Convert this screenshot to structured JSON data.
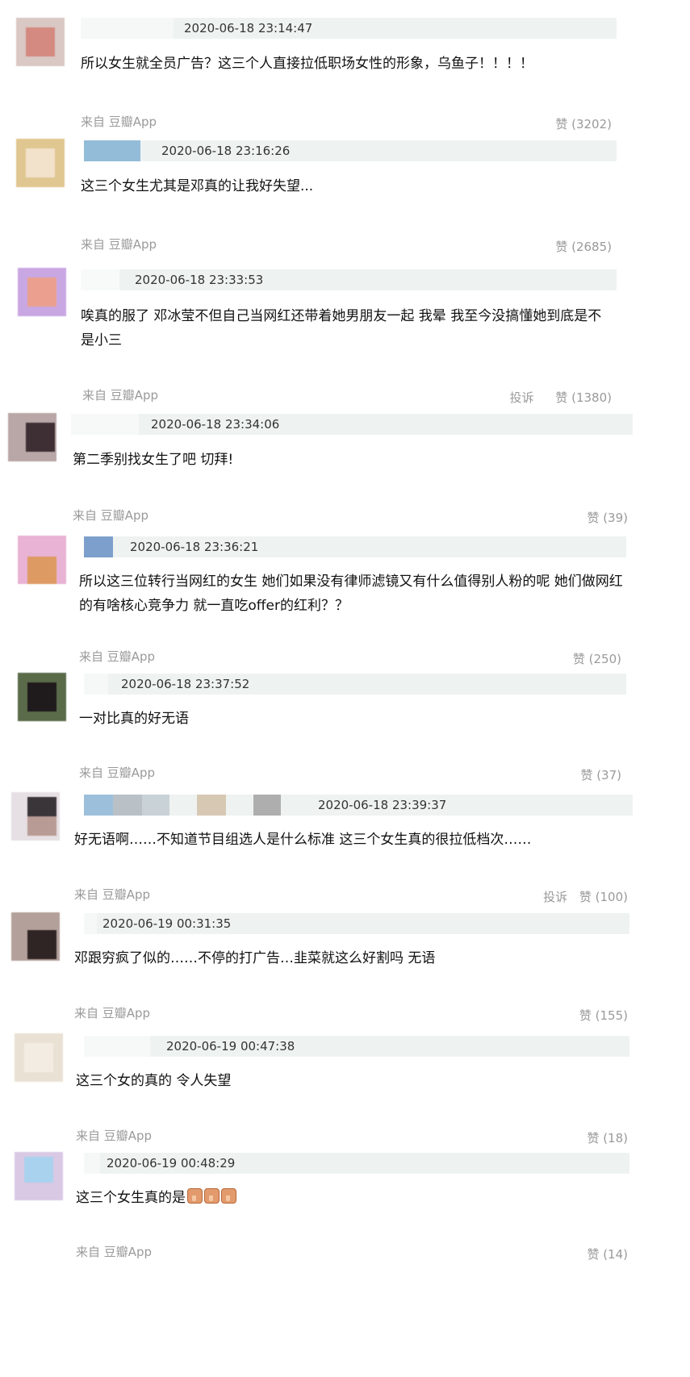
{
  "comments": [
    {
      "time": "2020-06-18 23:14:47",
      "text": "所以女生就全员广告？这三个人直接拉低职场女性的形象，乌鱼子！！！！",
      "source": "来自 豆瓣App",
      "like": "赞 (3202)",
      "report": ""
    },
    {
      "time": "2020-06-18 23:16:26",
      "text": "这三个女生尤其是邓真的让我好失望...",
      "source": "来自 豆瓣App",
      "like": "赞 (2685)",
      "report": ""
    },
    {
      "time": "2020-06-18 23:33:53",
      "text": "唉真的服了 邓冰莹不但自己当网红还带着她男朋友一起 我晕 我至今没搞懂她到底是不是小三",
      "source": "来自 豆瓣App",
      "like": "赞 (1380)",
      "report": "投诉"
    },
    {
      "time": "2020-06-18 23:34:06",
      "text": "第二季别找女生了吧 切拜!",
      "source": "来自 豆瓣App",
      "like": "赞 (39)",
      "report": ""
    },
    {
      "time": "2020-06-18 23:36:21",
      "text": "所以这三位转行当网红的女生 她们如果没有律师滤镜又有什么值得别人粉的呢 她们做网红的有啥核心竞争力 就一直吃offer的红利？？",
      "source": "来自 豆瓣App",
      "like": "赞 (250)",
      "report": ""
    },
    {
      "time": "2020-06-18 23:37:52",
      "text": "一对比真的好无语",
      "source": "来自 豆瓣App",
      "like": "赞 (37)",
      "report": ""
    },
    {
      "time": "2020-06-18 23:39:37",
      "text": "好无语啊……不知道节目组选人是什么标准 这三个女生真的很拉低档次……",
      "source": "来自 豆瓣App",
      "like": "赞 (100)",
      "report": "投诉"
    },
    {
      "time": "2020-06-19 00:31:35",
      "text": "邓跟穷疯了似的……不停的打广告…韭菜就这么好割吗 无语",
      "source": "来自 豆瓣App",
      "like": "赞 (155)",
      "report": ""
    },
    {
      "time": "2020-06-19 00:47:38",
      "text": "这三个女的真的 令人失望",
      "source": "来自 豆瓣App",
      "like": "赞 (18)",
      "report": ""
    },
    {
      "time": "2020-06-19 00:48:29",
      "text": "这三个女生真的是",
      "source": "来自 豆瓣App",
      "like": "赞 (14)",
      "report": ""
    }
  ],
  "icons": {
    "dislike": "thumbs-down-emoji"
  }
}
